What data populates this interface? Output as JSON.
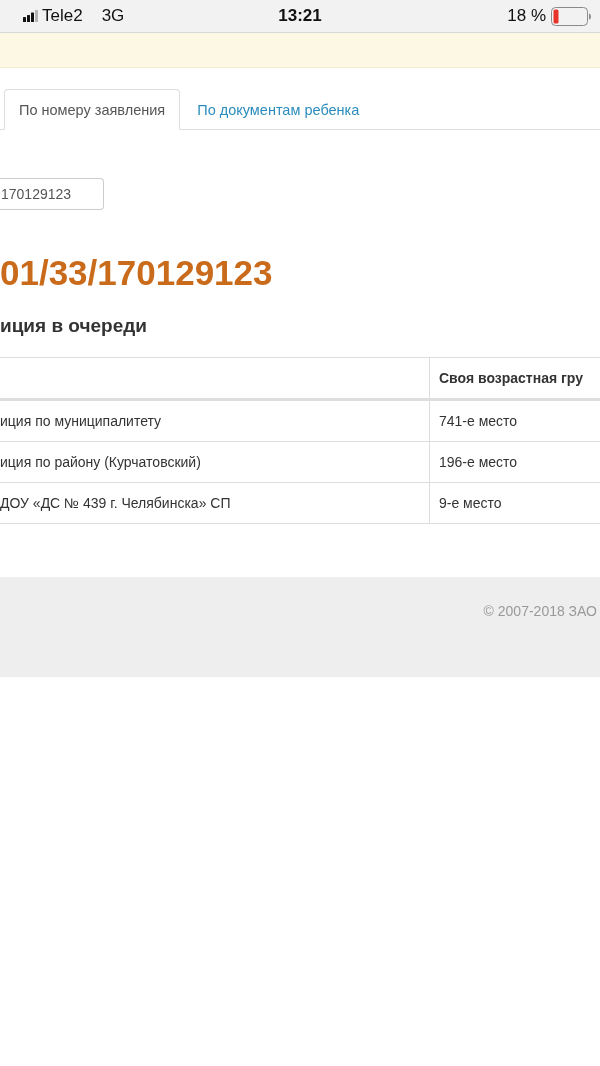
{
  "status_bar": {
    "carrier": "Tele2",
    "network": "3G",
    "time": "13:21",
    "battery_percent": "18 %"
  },
  "tabs": [
    {
      "label": "По номеру заявления",
      "selected": true
    },
    {
      "label": "По документам ребенка",
      "selected": false
    }
  ],
  "search": {
    "value": "170129123"
  },
  "application_number": "01/33/170129123",
  "queue": {
    "title": "иция в очереди",
    "table": {
      "header": "Своя возрастная гру",
      "rows": [
        {
          "name": "иция по муниципалитету",
          "place": "741-е место"
        },
        {
          "name": "иция по району (Курчатовский)",
          "place": "196-е место"
        },
        {
          "name": "ДОУ «ДС № 439 г. Челябинска» СП",
          "place": "9-е место"
        }
      ]
    }
  },
  "footer": {
    "copyright": "© 2007-2018 ЗАО"
  }
}
